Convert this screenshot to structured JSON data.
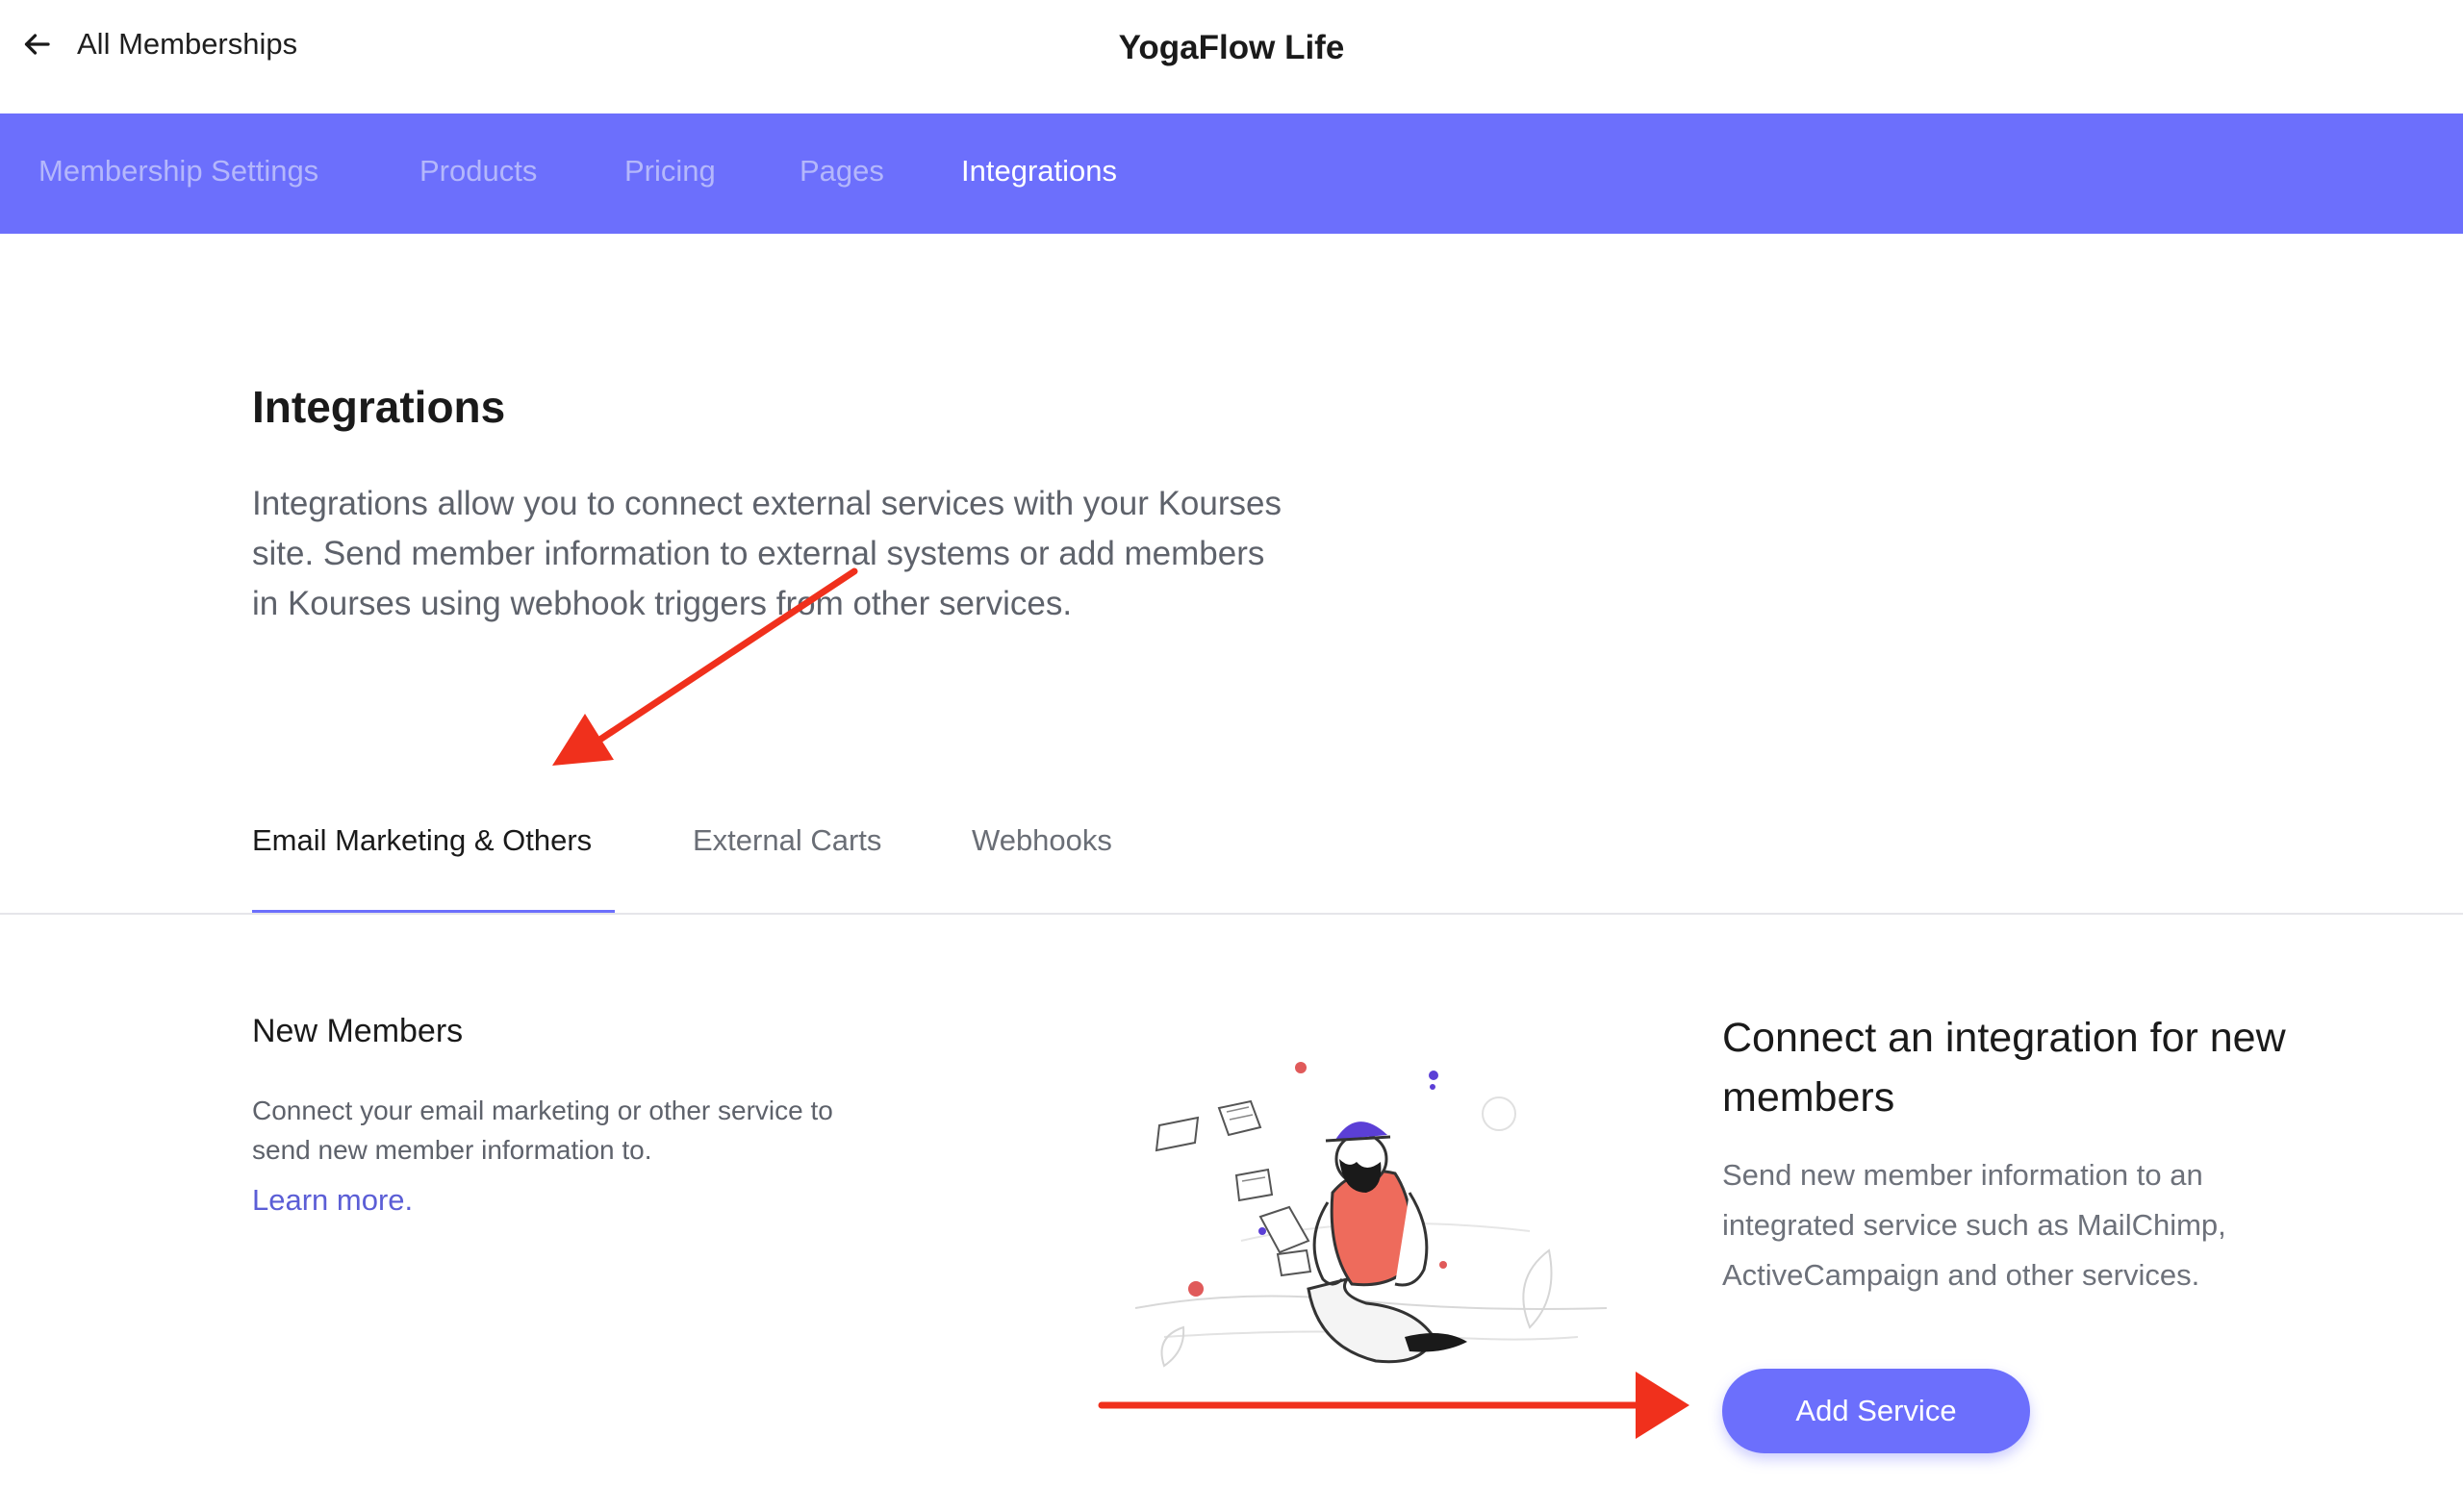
{
  "topbar": {
    "back_label": "All Memberships",
    "site_title": "YogaFlow Life"
  },
  "nav": {
    "items": [
      {
        "label": "Membership Settings",
        "active": false
      },
      {
        "label": "Products",
        "active": false
      },
      {
        "label": "Pricing",
        "active": false
      },
      {
        "label": "Pages",
        "active": false
      },
      {
        "label": "Integrations",
        "active": true
      }
    ]
  },
  "main": {
    "title": "Integrations",
    "intro_lines": [
      "Integrations allow you to connect external services with your Kourses",
      "site. Send member information to external systems or add members",
      "in Kourses using webhook triggers from other services."
    ],
    "tabs": [
      {
        "label": "Email Marketing & Others",
        "active": true
      },
      {
        "label": "External Carts",
        "active": false
      },
      {
        "label": "Webhooks",
        "active": false
      }
    ]
  },
  "new_members": {
    "title": "New Members",
    "desc_lines": [
      "Connect your email marketing or other service to",
      "send new member information to."
    ],
    "learn_more": "Learn more."
  },
  "cta": {
    "title_lines": [
      "Connect an integration for new",
      "members"
    ],
    "desc_lines": [
      "Send new member information to an",
      "integrated service such as MailChimp,",
      "ActiveCampaign and other services."
    ],
    "button_label": "Add Service"
  },
  "colors": {
    "accent": "#6c6ffc",
    "nav_inactive": "#b4b7fb",
    "annotation_arrow": "#f0301c"
  },
  "icons": {
    "back": "arrow-left-icon"
  }
}
